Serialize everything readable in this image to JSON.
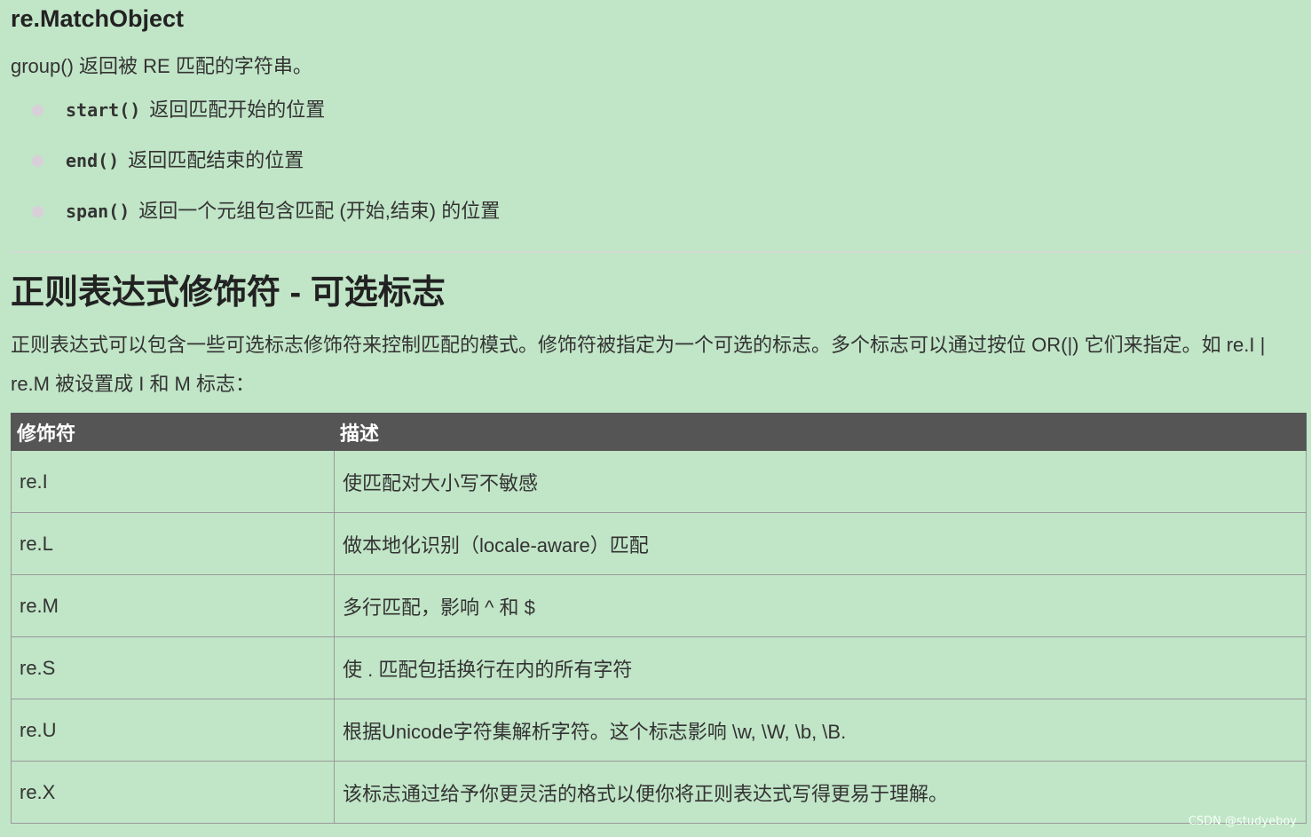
{
  "match_object": {
    "title": "re.MatchObject",
    "intro": "group() 返回被 RE 匹配的字符串。",
    "methods": [
      {
        "name": "start()",
        "desc": "返回匹配开始的位置"
      },
      {
        "name": "end()",
        "desc": "返回匹配结束的位置"
      },
      {
        "name": "span()",
        "desc": "返回一个元组包含匹配 (开始,结束) 的位置"
      }
    ]
  },
  "flags": {
    "title": "正则表达式修饰符 - 可选标志",
    "description": "正则表达式可以包含一些可选标志修饰符来控制匹配的模式。修饰符被指定为一个可选的标志。多个标志可以通过按位 OR(|) 它们来指定。如 re.I | re.M 被设置成 I 和 M 标志：",
    "table": {
      "headers": [
        "修饰符",
        "描述"
      ],
      "rows": [
        {
          "flag": "re.I",
          "desc": "使匹配对大小写不敏感"
        },
        {
          "flag": "re.L",
          "desc": "做本地化识别（locale-aware）匹配"
        },
        {
          "flag": "re.M",
          "desc": "多行匹配，影响 ^ 和 $"
        },
        {
          "flag": "re.S",
          "desc": "使 . 匹配包括换行在内的所有字符"
        },
        {
          "flag": "re.U",
          "desc": "根据Unicode字符集解析字符。这个标志影响 \\w, \\W, \\b, \\B."
        },
        {
          "flag": "re.X",
          "desc": "该标志通过给予你更灵活的格式以便你将正则表达式写得更易于理解。"
        }
      ]
    }
  },
  "watermark": "CSDN @studyeboy",
  "colors": {
    "background": "#c1e5c7",
    "table_header": "#555555",
    "bullet": "#d9cfd8"
  }
}
